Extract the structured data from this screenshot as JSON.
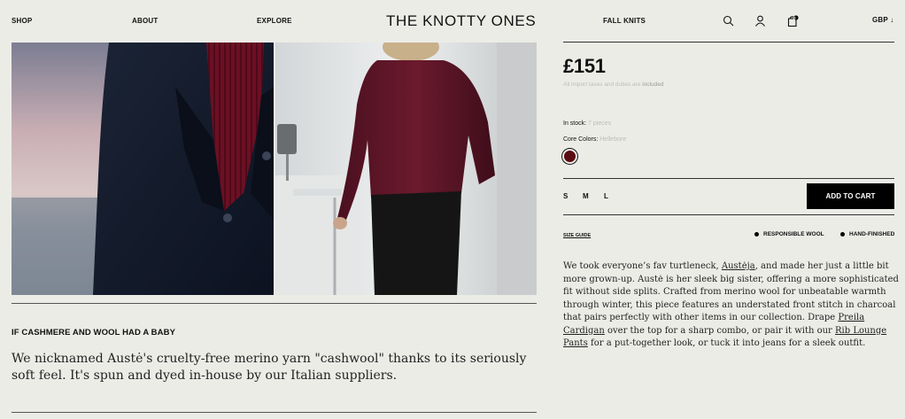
{
  "header": {
    "nav_left": [
      "SHOP",
      "ABOUT",
      "EXPLORE"
    ],
    "logo": "THE KNOTTY ONES",
    "nav_right": "FALL KNITS",
    "cart_count": "0",
    "currency": "GBP ↓",
    "icons": [
      "search-icon",
      "account-icon",
      "cart-icon"
    ]
  },
  "gallery": {
    "images": [
      "close-up of navy cardigan over burgundy ribbed turtleneck",
      "model from behind wearing burgundy turtleneck and black trousers"
    ]
  },
  "teaser": {
    "heading": "IF CASHMERE AND WOOL HAD A BABY",
    "text": "We nicknamed Austė's cruelty-free merino yarn \"cashwool\" thanks to its seriously soft feel. It's spun and dyed in-house by our Italian suppliers."
  },
  "product": {
    "price": "£151",
    "tax_note_prefix": "All import taxes and duties are ",
    "tax_note_strong": "included",
    "stock_label": "In stock:",
    "stock_value": "7 pieces",
    "color_label": "Core Colors:",
    "color_value": "Hellebore",
    "swatch_color": "#5a0d12",
    "sizes": [
      "S",
      "M",
      "L"
    ],
    "add_to_cart": "ADD TO CART",
    "size_guide": "SIZE GUIDE",
    "badges": [
      "RESPONSIBLE WOOL",
      "HAND-FINISHED"
    ],
    "desc_1": "We took everyone’s fav turtleneck, ",
    "link_1": "Austėja",
    "desc_2": ", and made her just a little bit more grown-up. Austė is her sleek big sister, offering a more sophisticated fit without side splits. Crafted from merino wool for unbeatable warmth through winter, this piece features an understated front stitch in charcoal that pairs perfectly with other items in our collection. Drape ",
    "link_2": "Preila Cardigan",
    "desc_3": " over the top for a sharp combo, or pair it with our ",
    "link_3": "Rib Lounge Pants",
    "desc_4": " for a put-together look, or tuck it into jeans for a sleek outfit."
  }
}
